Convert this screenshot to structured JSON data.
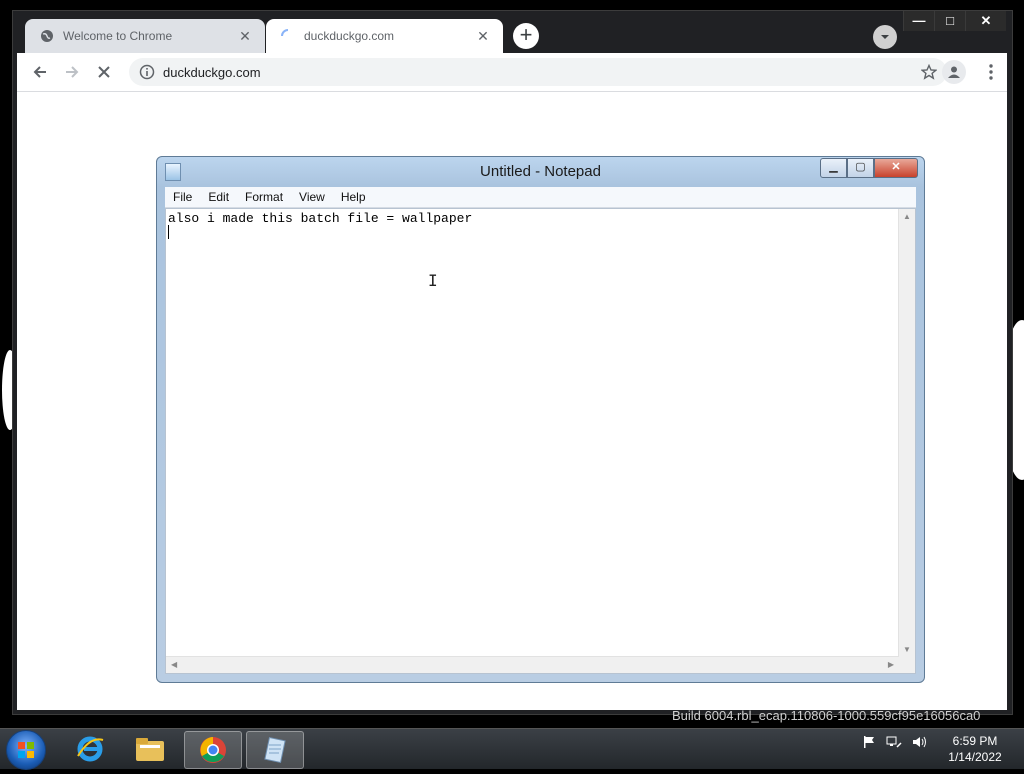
{
  "browser": {
    "tabs": [
      {
        "title": "Welcome to Chrome",
        "close": "✕"
      },
      {
        "title": "duckduckgo.com",
        "close": "✕"
      }
    ],
    "new_tab": "+",
    "url": "duckduckgo.com",
    "window_controls": {
      "minimize": "—",
      "maximize": "□",
      "close": "✕"
    }
  },
  "notepad": {
    "title": "Untitled - Notepad",
    "menu": [
      "File",
      "Edit",
      "Format",
      "View",
      "Help"
    ],
    "content": "also i made this batch file = wallpaper",
    "controls": {
      "minimize": "▁",
      "maximize": "▢",
      "close": "✕"
    }
  },
  "watermark": "Build 6004.rbl_ecap.110806-1000.559cf95e16056ca0",
  "taskbar": {
    "time": "6:59 PM",
    "date": "1/14/2022"
  },
  "colors": {
    "chrome_frame": "#202124",
    "taskbar": "#23272b",
    "notepad_frame": "#a9c3de"
  }
}
